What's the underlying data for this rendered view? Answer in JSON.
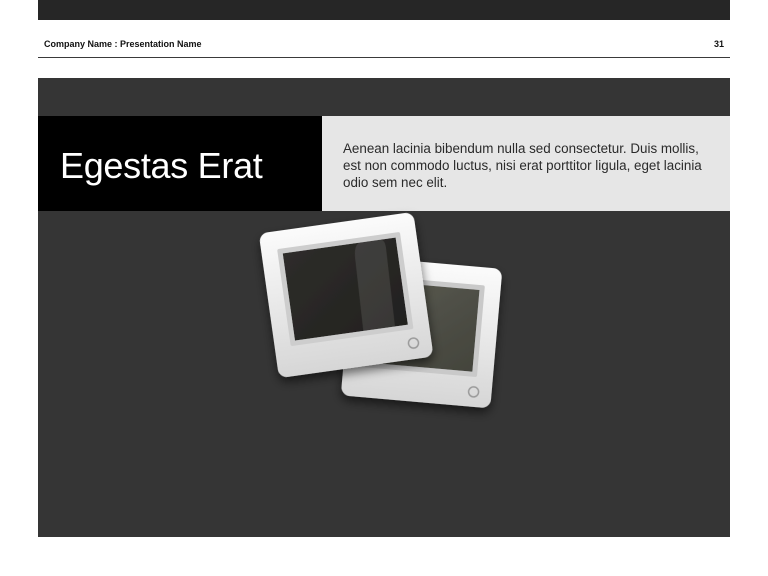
{
  "header": {
    "left_text": "Company Name : Presentation Name",
    "page_number": "31"
  },
  "slide": {
    "title": "Egestas Erat",
    "description": "Aenean lacinia bibendum nulla sed consectetur. Duis mollis, est non commodo luctus, nisi erat porttitor ligula, eget lacinia odio sem nec elit."
  },
  "colors": {
    "slide_background": "#353535",
    "title_block": "#000000",
    "description_block": "#e6e6e6",
    "top_bar": "#262626"
  },
  "illustration": {
    "icon": "photo-slides-icon"
  }
}
